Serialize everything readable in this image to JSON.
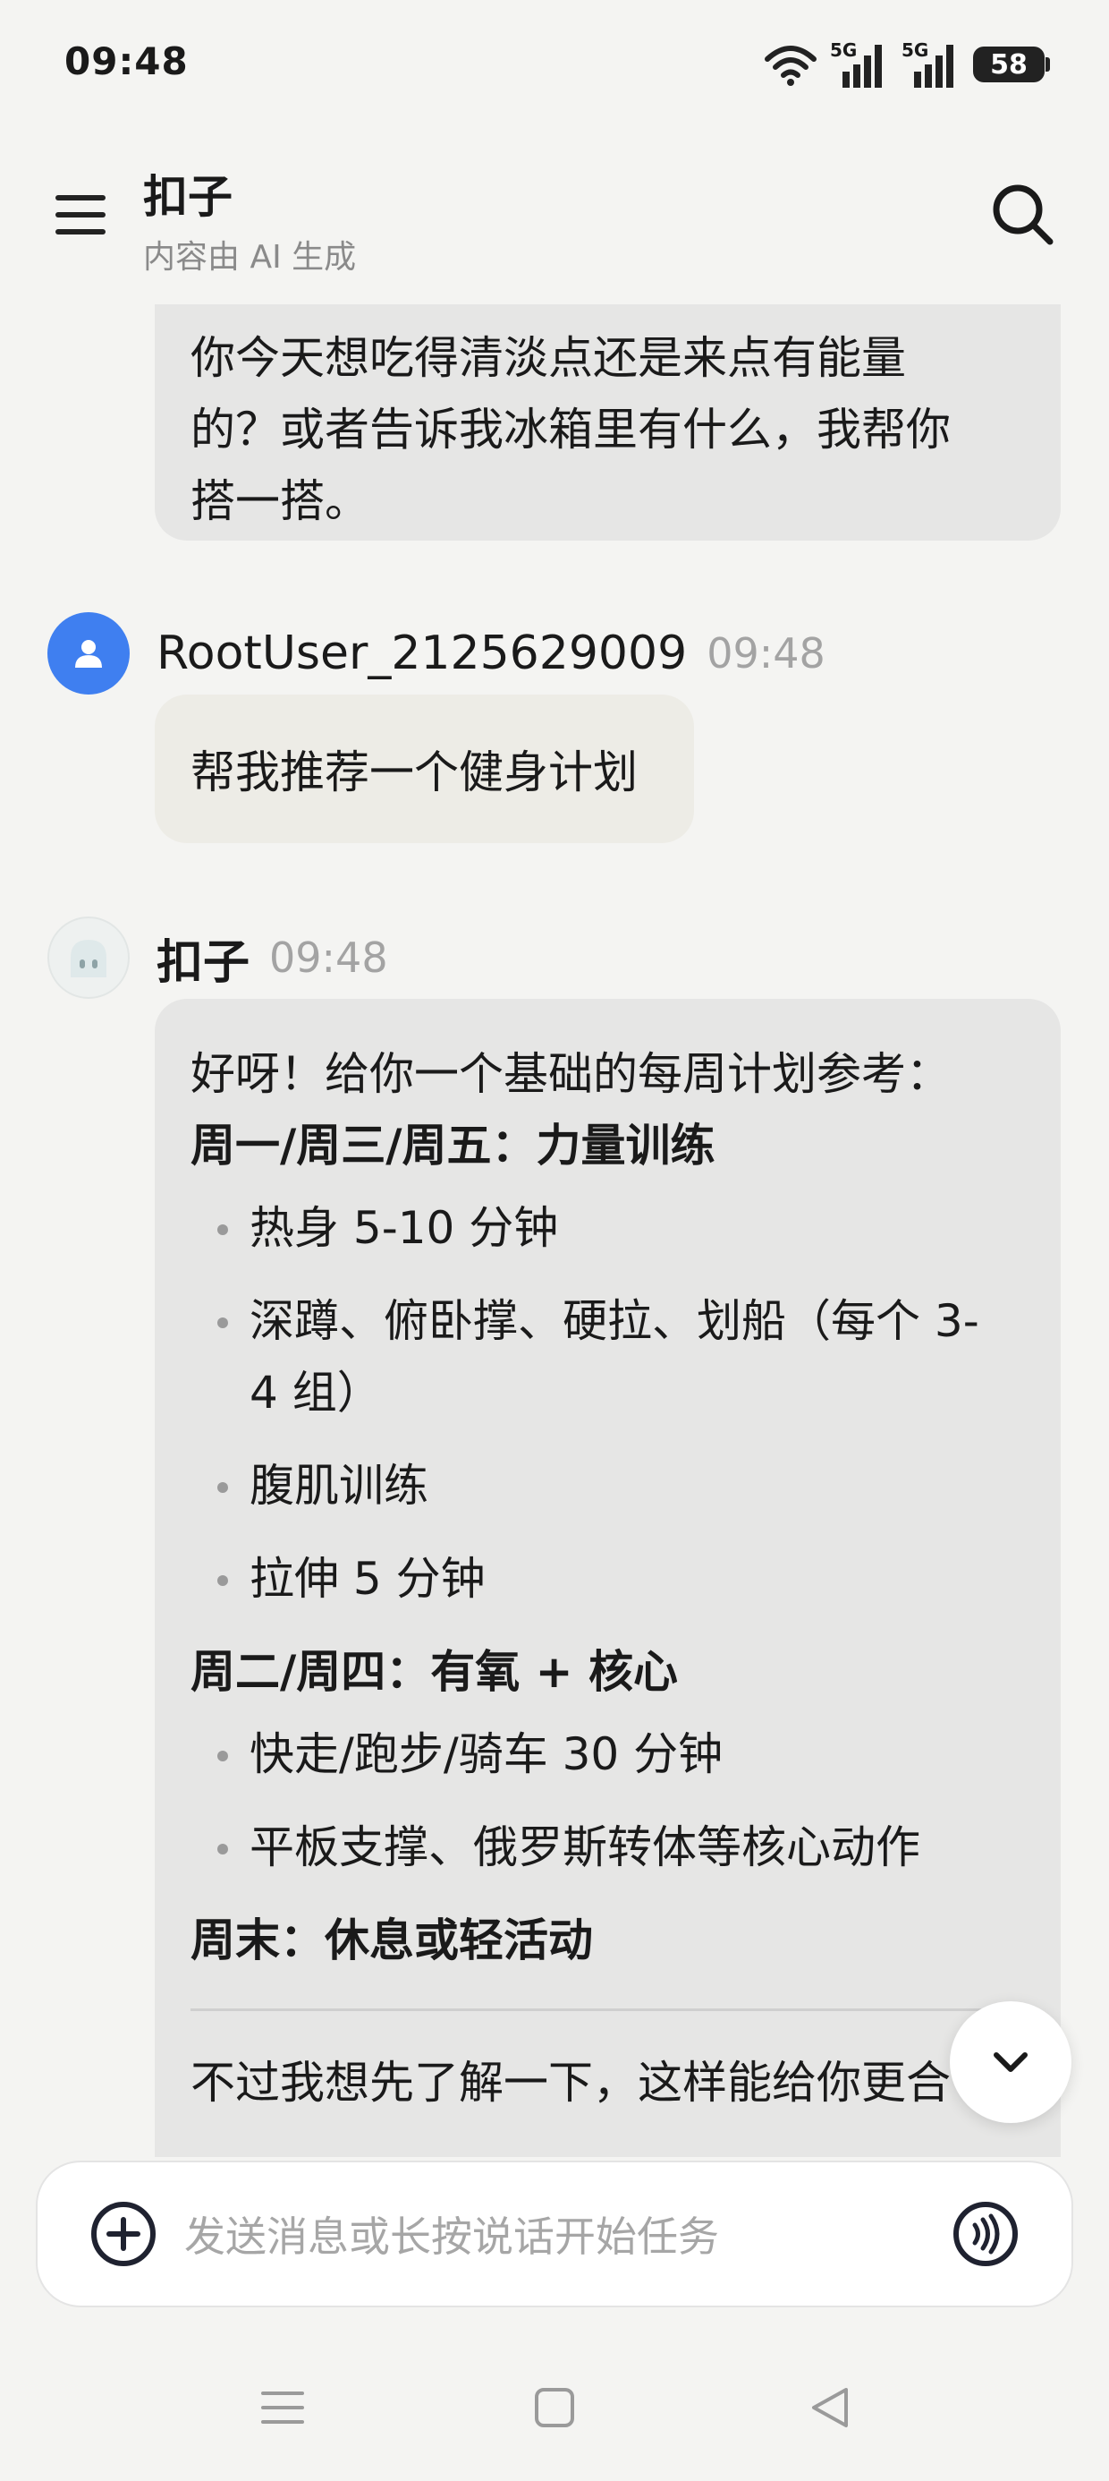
{
  "status_bar": {
    "time": "09:48",
    "network_1": "5G",
    "network_2": "5G",
    "battery": "58"
  },
  "header": {
    "title": "扣子",
    "subtitle": "内容由 AI 生成"
  },
  "messages": {
    "previous_bot_tail": [
      "你今天想吃得清淡点还是来点有能量",
      "的？或者告诉我冰箱里有什么，我帮你",
      "搭一搭。"
    ],
    "user": {
      "name": "RootUser_2125629009",
      "time": "09:48",
      "text": "帮我推荐一个健身计划"
    },
    "bot": {
      "name": "扣子",
      "time": "09:48",
      "intro": "好呀！给你一个基础的每周计划参考：",
      "sections": [
        {
          "heading": "周一/周三/周五：力量训练",
          "items": [
            "热身 5-10 分钟",
            "深蹲、俯卧撑、硬拉、划船（每个 3-4 组）",
            "腹肌训练",
            "拉伸 5 分钟"
          ]
        },
        {
          "heading": "周二/周四：有氧 + 核心",
          "items": [
            "快走/跑步/骑车 30 分钟",
            "平板支撑、俄罗斯转体等核心动作"
          ]
        },
        {
          "heading": "周末：休息或轻活动",
          "items": []
        }
      ],
      "follow_up": "不过我想先了解一下，这样能给你更合"
    }
  },
  "input": {
    "placeholder": "发送消息或长按说话开始任务"
  }
}
